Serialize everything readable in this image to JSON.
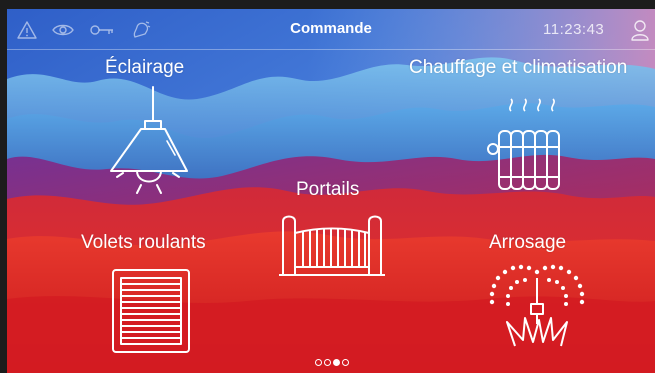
{
  "header": {
    "title": "Commande",
    "time": "11:23:43",
    "icons": [
      "warning-icon",
      "eye-icon",
      "key-icon",
      "alarm-bell-icon",
      "user-icon"
    ]
  },
  "tiles": [
    {
      "label": "Éclairage",
      "icon": "ceiling-lamp-icon"
    },
    {
      "label": "Chauffage et climatisation",
      "icon": "radiator-icon"
    },
    {
      "label": "Portails",
      "icon": "gate-icon"
    },
    {
      "label": "Volets roulants",
      "icon": "roller-shutter-icon"
    },
    {
      "label": "Arrosage",
      "icon": "sprinkler-icon"
    }
  ],
  "pagination": {
    "total": 4,
    "active": 3
  },
  "colors": {
    "sky_blue": "#3a6fd0",
    "mountain_red": "#d8242c",
    "text": "#ffffff"
  }
}
